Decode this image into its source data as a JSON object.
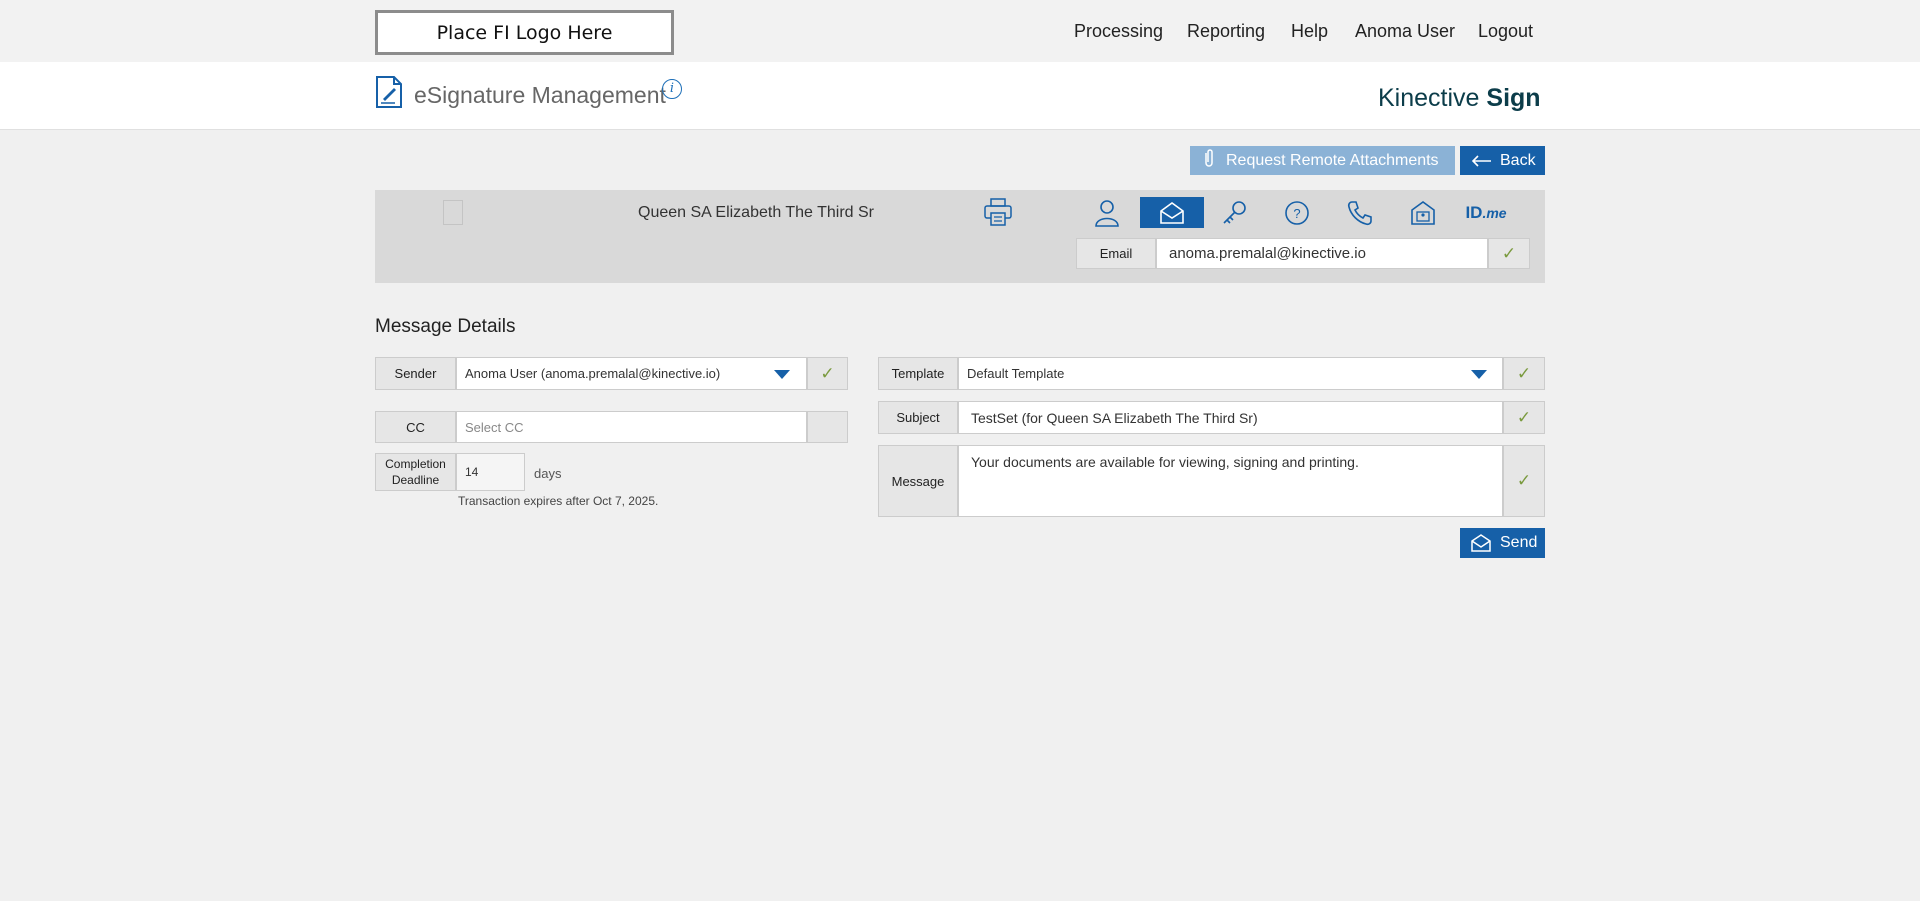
{
  "topbar": {
    "logo_text": "Place FI Logo Here",
    "nav": [
      "Processing",
      "Reporting",
      "Help",
      "Anoma User",
      "Logout"
    ]
  },
  "header": {
    "title": "eSignature Management",
    "info_symbol": "i",
    "brand_light": "Kinective ",
    "brand_bold": "Sign"
  },
  "actions": {
    "request_attachments": "Request Remote Attachments",
    "back": "Back",
    "send": "Send"
  },
  "signer": {
    "name": "Queen SA Elizabeth The Third Sr",
    "auth_methods": [
      "person-icon",
      "email-icon",
      "key-icon",
      "question-shield-icon",
      "phone-icon",
      "id-card-icon",
      "idme-icon"
    ],
    "active_method": "email-icon",
    "idme_text": "ID",
    "idme_suffix": ".me",
    "email_label": "Email",
    "email_value": "anoma.premalal@kinective.io"
  },
  "message_details": {
    "title": "Message Details",
    "sender_label": "Sender",
    "sender_value": "Anoma User (anoma.premalal@kinective.io)",
    "cc_label": "CC",
    "cc_placeholder": "Select CC",
    "deadline_label": "Completion Deadline",
    "deadline_value": "14",
    "deadline_unit": "days",
    "expires_text": "Transaction expires after Oct 7, 2025.",
    "template_label": "Template",
    "template_value": "Default Template",
    "subject_label": "Subject",
    "subject_value": "TestSet (for Queen SA Elizabeth The Third Sr)",
    "message_label": "Message",
    "message_value": "Your documents are available for viewing, signing and printing."
  },
  "colors": {
    "primary": "#1660a8",
    "primary_light": "#8bb2d6",
    "check": "#7a9a3e",
    "background": "#f0f0f0"
  }
}
